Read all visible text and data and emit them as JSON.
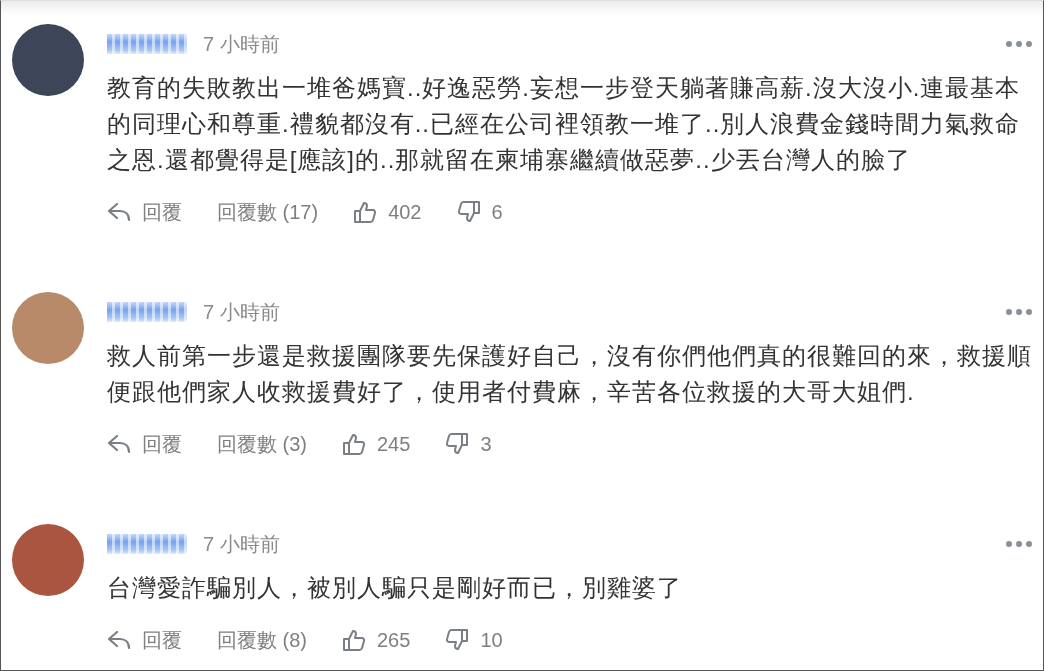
{
  "comments": [
    {
      "avatar": {
        "color": "#3c4658"
      },
      "time": "7 小時前",
      "text": "教育的失敗教出一堆爸媽寶..好逸惡勞.妄想一步登天躺著賺高薪.沒大沒小.連最基本的同理心和尊重.禮貌都沒有..已經在公司裡領教一堆了..別人浪費金錢時間力氣救命之恩.還都覺得是[應該]的..那就留在柬埔寨繼續做惡夢..少丟台灣人的臉了",
      "actions": {
        "reply": "回覆",
        "reply_count": "回覆數 (17)",
        "likes": "402",
        "dislikes": "6"
      }
    },
    {
      "avatar": {
        "color": "#b98a6a"
      },
      "time": "7 小時前",
      "text": "救人前第一步還是救援團隊要先保護好自己，沒有你們他們真的很難回的來，救援順便跟他們家人收救援費好了，使用者付費麻，辛苦各位救援的大哥大姐們.",
      "actions": {
        "reply": "回覆",
        "reply_count": "回覆數 (3)",
        "likes": "245",
        "dislikes": "3"
      }
    },
    {
      "avatar": {
        "color": "#a9553f"
      },
      "time": "7 小時前",
      "text": "台灣愛詐騙別人，被別人騙只是剛好而已，別雞婆了",
      "actions": {
        "reply": "回覆",
        "reply_count": "回覆數 (8)",
        "likes": "265",
        "dislikes": "10"
      }
    }
  ]
}
